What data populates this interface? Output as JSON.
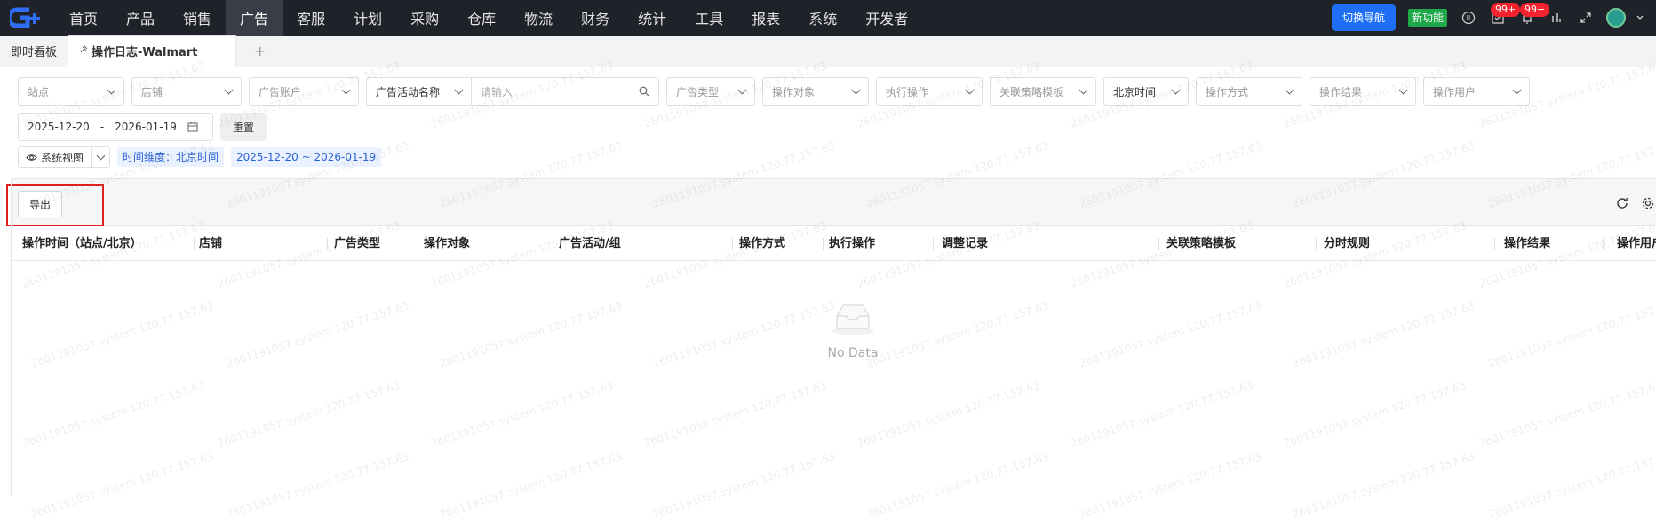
{
  "nav": {
    "items": [
      "首页",
      "产品",
      "销售",
      "广告",
      "客服",
      "计划",
      "采购",
      "仓库",
      "物流",
      "财务",
      "统计",
      "工具",
      "报表",
      "系统",
      "开发者"
    ],
    "active_index": 3,
    "switch_nav": "切换导航",
    "new_feature": "新功能",
    "badge_tasks": "99+",
    "badge_bell": "99+"
  },
  "tabs": {
    "dashboard": "即时看板",
    "active": "操作日志-Walmart",
    "add": "+"
  },
  "filters": {
    "site": "站点",
    "store": "店铺",
    "ad_account": "广告账户",
    "campaign_field": "广告活动名称",
    "campaign_placeholder": "请输入",
    "ad_type": "广告类型",
    "op_object": "操作对象",
    "exec_op": "执行操作",
    "strategy_template": "关联策略模板",
    "timezone": "北京时间",
    "op_method": "操作方式",
    "op_result": "操作结果",
    "op_user": "操作用户",
    "date_start": "2025-12-20",
    "date_sep": "-",
    "date_end": "2026-01-19",
    "reset": "重置",
    "system_view": "系统视图",
    "time_dimension": "时间维度：北京时间",
    "date_tag": "2025-12-20 ~ 2026-01-19"
  },
  "toolbar": {
    "export": "导出"
  },
  "table": {
    "columns": [
      "操作时间（站点/北京）",
      "店铺",
      "广告类型",
      "操作对象",
      "广告活动/组",
      "操作方式",
      "执行操作",
      "调整记录",
      "关联策略模板",
      "分时规则",
      "操作结果",
      "操作用户"
    ],
    "empty_text": "No Data"
  },
  "watermark": "2601191057 system 120.77.157.63",
  "colors": {
    "topbar": "#20222a",
    "primary": "#1e6ff5",
    "new_badge": "#1ea84a",
    "highlight": "#e02020"
  }
}
